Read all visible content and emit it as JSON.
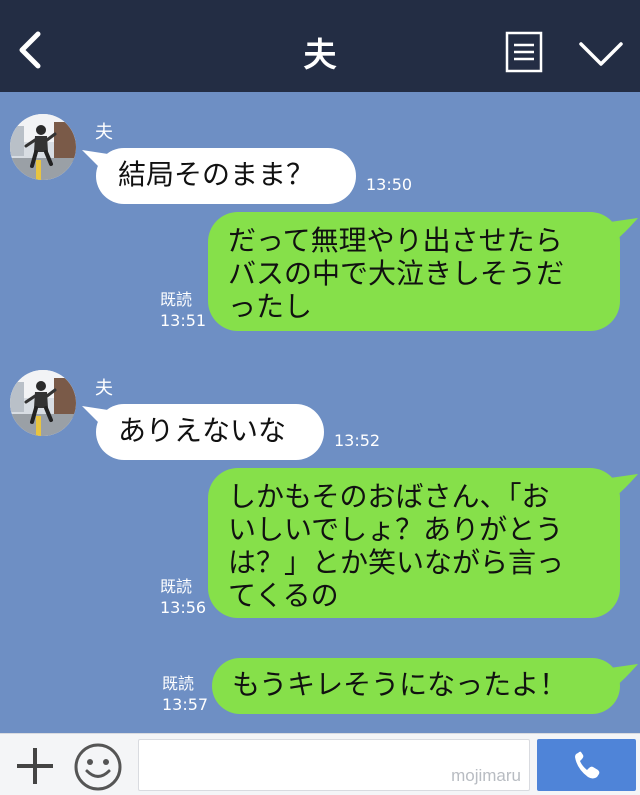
{
  "header": {
    "title": "夫",
    "icons": {
      "back": "chevron-left-icon",
      "menu": "note-icon",
      "collapse": "chevron-down-icon"
    }
  },
  "messages": [
    {
      "direction": "in",
      "sender": "夫",
      "text": "結局そのまま？",
      "time": "13:50"
    },
    {
      "direction": "out",
      "lines": [
        "だって無理やり出させたら",
        "バスの中で大泣きしそうだ",
        "ったし"
      ],
      "read": "既読",
      "time": "13:51"
    },
    {
      "direction": "in",
      "sender": "夫",
      "text": "ありえないな",
      "time": "13:52"
    },
    {
      "direction": "out",
      "lines": [
        "しかもそのおばさん、「お",
        "いしいでしょ？ありがとう",
        "は？」とか笑いながら言っ",
        "てくるの"
      ],
      "read": "既読",
      "time": "13:56"
    },
    {
      "direction": "out",
      "text": "もうキレそうになったよ！",
      "read": "既読",
      "time": "13:57"
    }
  ],
  "inputbar": {
    "value": "",
    "watermark": "mojimaru",
    "icons": {
      "plus": "plus-icon",
      "emoji": "smiley-icon",
      "call": "phone-icon"
    }
  },
  "colors": {
    "header": "#232d44",
    "chat_background": "#6e8fc4",
    "incoming_bubble": "#ffffff",
    "outgoing_bubble": "#86e04a",
    "call_button": "#4f84d8"
  }
}
